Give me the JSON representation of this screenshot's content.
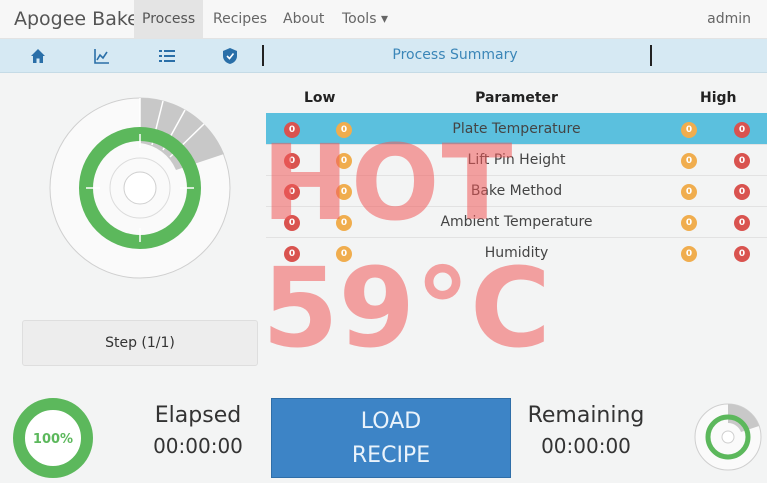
{
  "app": {
    "title": "Apogee Bake",
    "user": "admin"
  },
  "nav": {
    "items": [
      "Process",
      "Recipes",
      "About",
      "Tools ▾"
    ],
    "active": "Process"
  },
  "subnav": {
    "title": "Process Summary",
    "icons": [
      "home-icon",
      "chart-icon",
      "list-icon",
      "shield-icon"
    ]
  },
  "colors": {
    "ok": "#5cb85c",
    "inactive": "#c8c8c8",
    "accent": "#3d84c6",
    "selected_row": "#5bc0de",
    "alarm": "#d9534f",
    "warn": "#f0ad4e"
  },
  "step": {
    "label": "Step (1/1)"
  },
  "params": {
    "headers": {
      "low": "Low",
      "param": "Parameter",
      "high": "High"
    },
    "rows": [
      {
        "name": "Plate Temperature",
        "low_alarm": "0",
        "low_warn": "0",
        "high_warn": "0",
        "high_alarm": "0",
        "selected": true
      },
      {
        "name": "Lift Pin Height",
        "low_alarm": "0",
        "low_warn": "0",
        "high_warn": "0",
        "high_alarm": "0",
        "selected": false
      },
      {
        "name": "Bake Method",
        "low_alarm": "0",
        "low_warn": "0",
        "high_warn": "0",
        "high_alarm": "0",
        "selected": false
      },
      {
        "name": "Ambient Temperature",
        "low_alarm": "0",
        "low_warn": "0",
        "high_warn": "0",
        "high_alarm": "0",
        "selected": false
      },
      {
        "name": "Humidity",
        "low_alarm": "0",
        "low_warn": "0",
        "high_warn": "0",
        "high_alarm": "0",
        "selected": false
      }
    ]
  },
  "status": {
    "overlay_text": "HOT",
    "temperature": "59°C"
  },
  "progress": {
    "label": "100%",
    "value": 1.0
  },
  "elapsed": {
    "label": "Elapsed",
    "value": "00:00:00"
  },
  "remaining": {
    "label": "Remaining",
    "value": "00:00:00"
  },
  "load_button": {
    "line1": "LOAD",
    "line2": "RECIPE"
  }
}
